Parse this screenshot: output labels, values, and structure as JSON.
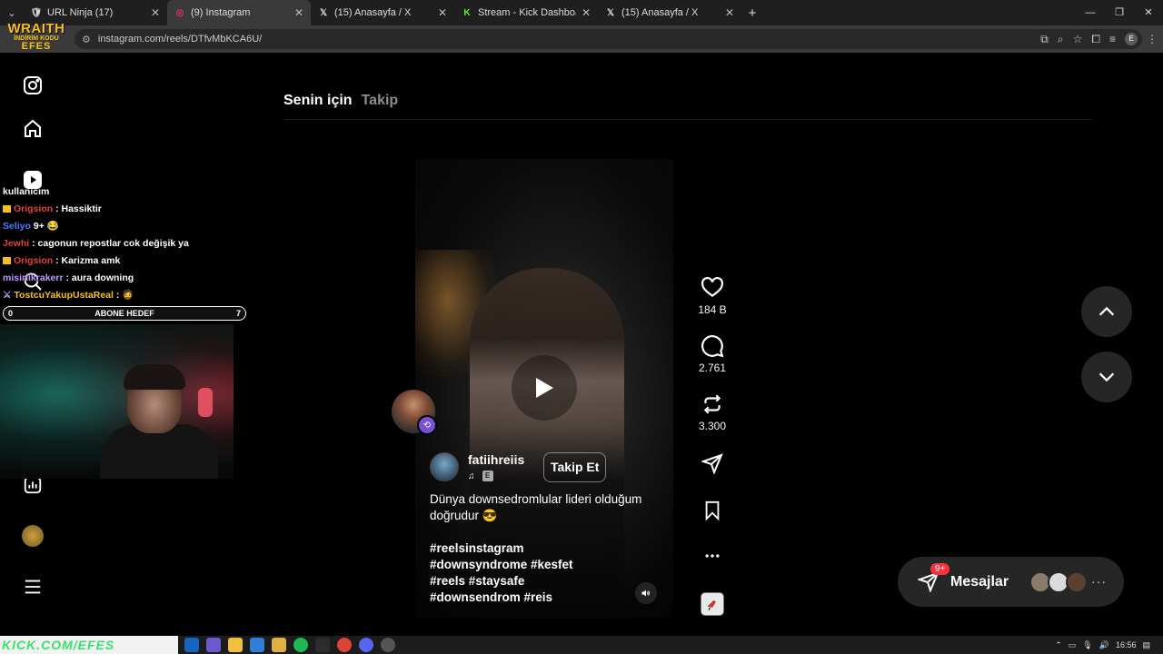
{
  "browser": {
    "tabs": [
      {
        "title": "URL Ninja (17)",
        "icon": "url-ninja-icon",
        "active": false
      },
      {
        "title": "(9) Instagram",
        "icon": "instagram-icon",
        "active": true
      },
      {
        "title": "(15) Anasayfa / X",
        "icon": "x-icon",
        "active": false
      },
      {
        "title": "Stream - Kick Dashboard",
        "icon": "kick-icon",
        "active": false
      },
      {
        "title": "(15) Anasayfa / X",
        "icon": "x-icon",
        "active": false
      }
    ],
    "new_tab": "+",
    "url": "instagram.com/reels/DTfvMbKCA6U/",
    "profile_initial": "E"
  },
  "overlay_logo": {
    "line1": "WRAITH",
    "line2": "İNDİRİM KODU",
    "line3": "EFES"
  },
  "feed_tabs": {
    "active": "Senin için",
    "inactive": "Takip"
  },
  "reel": {
    "author": "fatiihreiis",
    "badge_letter": "E",
    "follow_label": "Takip Et",
    "caption": "Dünya downsedromlular lideri olduğum doğrudur 😎",
    "hashtags": [
      "#reelsinstagram",
      "#downsyndrome #kesfet",
      "#reels #staysafe",
      "#downsendrom #reis"
    ],
    "likes": "184 B",
    "comments": "2.761",
    "reposts": "3.300"
  },
  "messages": {
    "label": "Mesajlar",
    "badge": "9+"
  },
  "stream_chat": {
    "header": "kullanıcım",
    "lines": [
      {
        "user": "Origsion",
        "color": "#e0433e",
        "text": " : Hassiktir",
        "badge": true
      },
      {
        "user": "Seliyo",
        "color": "#4f7cff",
        "text": " 9+ 😂",
        "badge": false
      },
      {
        "user": "Jewhi",
        "color": "#e0433e",
        "text": " : cagonun repostlar cok değişik ya",
        "badge": false
      },
      {
        "user": "Origsion",
        "color": "#e0433e",
        "text": " : Karizma amk",
        "badge": true
      },
      {
        "user": "misiriikrakerr",
        "color": "#c29cff",
        "text": " : aura downing",
        "badge": false
      },
      {
        "user": "TostcuYakupUstaReal",
        "color": "#f4c01e",
        "text": " : 🧔",
        "badge": false
      }
    ],
    "goal": {
      "left": "0",
      "label": "ABONE HEDEF",
      "right": "7"
    }
  },
  "taskbar": {
    "watermark": "KICK.COM/EFES",
    "time": "16:56"
  }
}
